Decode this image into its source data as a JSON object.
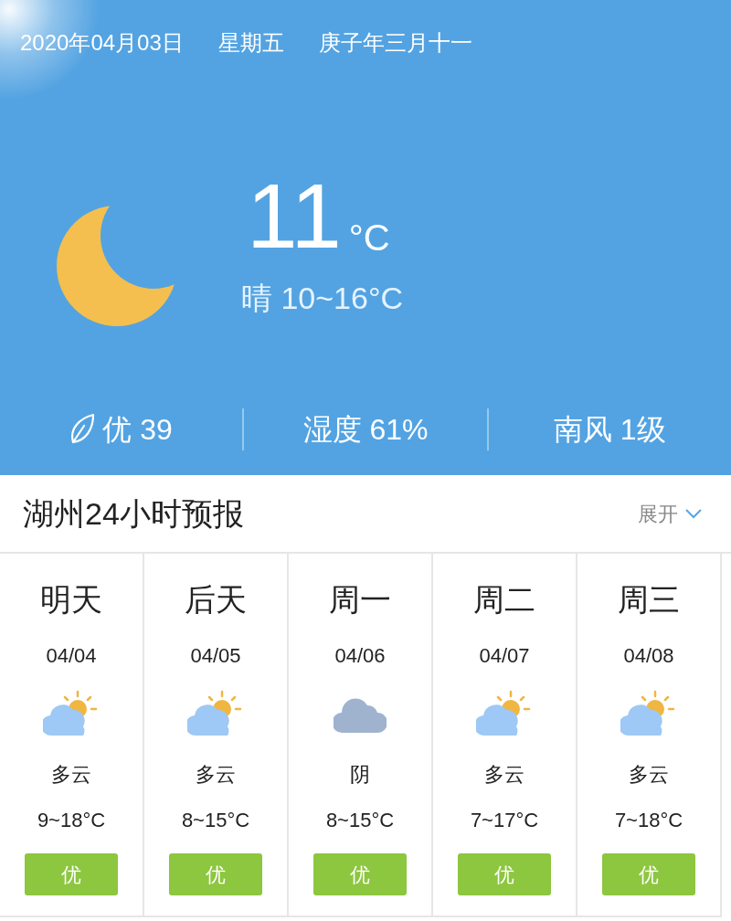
{
  "header": {
    "date": "2020年04月03日",
    "weekday": "星期五",
    "lunar_date": "庚子年三月十一"
  },
  "current": {
    "kind": "moon",
    "temperature": "11",
    "unit": "°C",
    "summary": "晴 10~16°C"
  },
  "stats": [
    {
      "kind": "air",
      "text": "优 39"
    },
    {
      "kind": "plain",
      "text": "湿度 61%"
    },
    {
      "kind": "plain",
      "text": "南风 1级"
    }
  ],
  "forecast": {
    "title": "湖州24小时预报",
    "expand": "展开",
    "days": [
      {
        "day": "明天",
        "date": "04/04",
        "kind": "partly_cloudy",
        "condition": "多云",
        "range": "9~18°C",
        "aqi": "优"
      },
      {
        "day": "后天",
        "date": "04/05",
        "kind": "partly_cloudy",
        "condition": "多云",
        "range": "8~15°C",
        "aqi": "优"
      },
      {
        "day": "周一",
        "date": "04/06",
        "kind": "cloudy",
        "condition": "阴",
        "range": "8~15°C",
        "aqi": "优"
      },
      {
        "day": "周二",
        "date": "04/07",
        "kind": "partly_cloudy",
        "condition": "多云",
        "range": "7~17°C",
        "aqi": "优"
      },
      {
        "day": "周三",
        "date": "04/08",
        "kind": "partly_cloudy",
        "condition": "多云",
        "range": "7~18°C",
        "aqi": "优"
      }
    ]
  }
}
